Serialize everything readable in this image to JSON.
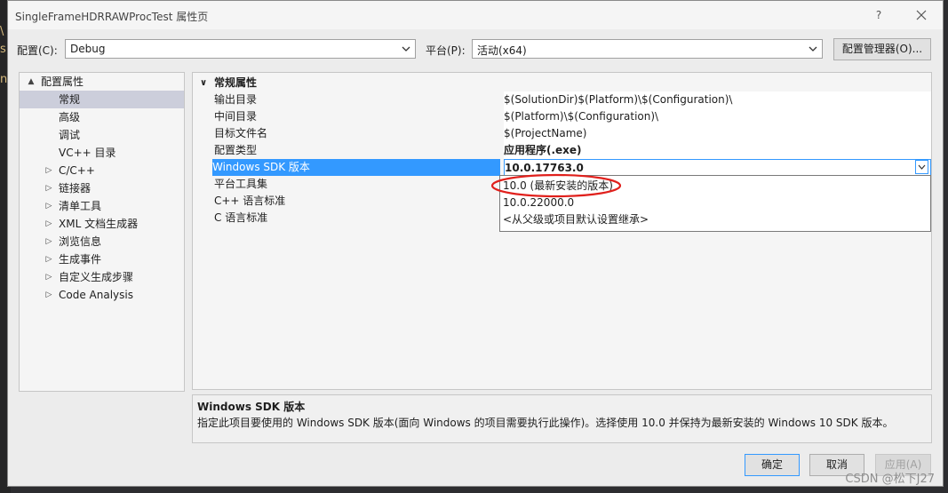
{
  "window": {
    "title": "SingleFrameHDRRAWProcTest 属性页",
    "help_label": "?"
  },
  "toolbar": {
    "config_label": "配置(C):",
    "config_value": "Debug",
    "platform_label": "平台(P):",
    "platform_value": "活动(x64)",
    "config_manager_label": "配置管理器(O)..."
  },
  "tree": {
    "items": [
      {
        "label": "配置属性",
        "expander": "▲"
      },
      {
        "label": "常规",
        "expander": ""
      },
      {
        "label": "高级",
        "expander": ""
      },
      {
        "label": "调试",
        "expander": ""
      },
      {
        "label": "VC++ 目录",
        "expander": ""
      },
      {
        "label": "C/C++",
        "expander": "▷"
      },
      {
        "label": "链接器",
        "expander": "▷"
      },
      {
        "label": "清单工具",
        "expander": "▷"
      },
      {
        "label": "XML 文档生成器",
        "expander": "▷"
      },
      {
        "label": "浏览信息",
        "expander": "▷"
      },
      {
        "label": "生成事件",
        "expander": "▷"
      },
      {
        "label": "自定义生成步骤",
        "expander": "▷"
      },
      {
        "label": "Code Analysis",
        "expander": "▷"
      }
    ]
  },
  "grid": {
    "category": "常规属性",
    "category_toggle": "∨",
    "rows": [
      {
        "name": "输出目录",
        "value": "$(SolutionDir)$(Platform)\\$(Configuration)\\"
      },
      {
        "name": "中间目录",
        "value": "$(Platform)\\$(Configuration)\\"
      },
      {
        "name": "目标文件名",
        "value": "$(ProjectName)"
      },
      {
        "name": "配置类型",
        "value": "应用程序(.exe)"
      },
      {
        "name": "Windows SDK 版本",
        "value": "10.0.17763.0"
      },
      {
        "name": "平台工具集",
        "value": ""
      },
      {
        "name": "C++ 语言标准",
        "value": ""
      },
      {
        "name": "C 语言标准",
        "value": ""
      }
    ],
    "sdk_dropdown_options": [
      "10.0 (最新安装的版本)",
      "10.0.22000.0",
      "<从父级或项目默认设置继承>"
    ]
  },
  "description": {
    "title": "Windows SDK 版本",
    "text": "指定此项目要使用的 Windows SDK 版本(面向 Windows 的项目需要执行此操作)。选择使用 10.0 并保持为最新安装的 Windows 10 SDK 版本。"
  },
  "buttons": {
    "ok": "确定",
    "cancel": "取消",
    "apply": "应用(A)"
  },
  "watermark": "CSDN @松下J27",
  "colors": {
    "selection": "#3399ff",
    "tree_selected": "#cccedb",
    "annotation_ring": "#e0201c"
  }
}
